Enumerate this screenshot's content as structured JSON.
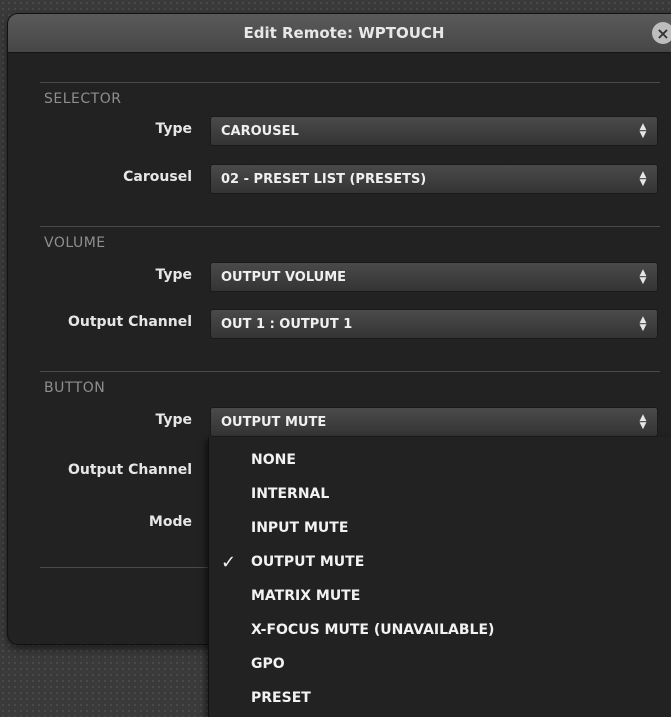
{
  "dialog": {
    "title": "Edit Remote: WPTOUCH",
    "close_symbol": "×"
  },
  "selector": {
    "section": "SELECTOR",
    "type_label": "Type",
    "type_value": "CAROUSEL",
    "carousel_label": "Carousel",
    "carousel_value": "02 - PRESET LIST (PRESETS)"
  },
  "volume": {
    "section": "VOLUME",
    "type_label": "Type",
    "type_value": "OUTPUT VOLUME",
    "channel_label": "Output Channel",
    "channel_value": "OUT 1 : OUTPUT 1"
  },
  "button": {
    "section": "BUTTON",
    "type_label": "Type",
    "type_value": "OUTPUT MUTE",
    "channel_label": "Output Channel",
    "mode_label": "Mode"
  },
  "dropdown": {
    "options": [
      "NONE",
      "INTERNAL",
      "INPUT MUTE",
      "OUTPUT MUTE",
      "MATRIX MUTE",
      "X-FOCUS MUTE (UNAVAILABLE)",
      "GPO",
      "PRESET"
    ],
    "selected": "OUTPUT MUTE",
    "check_symbol": "✓"
  }
}
